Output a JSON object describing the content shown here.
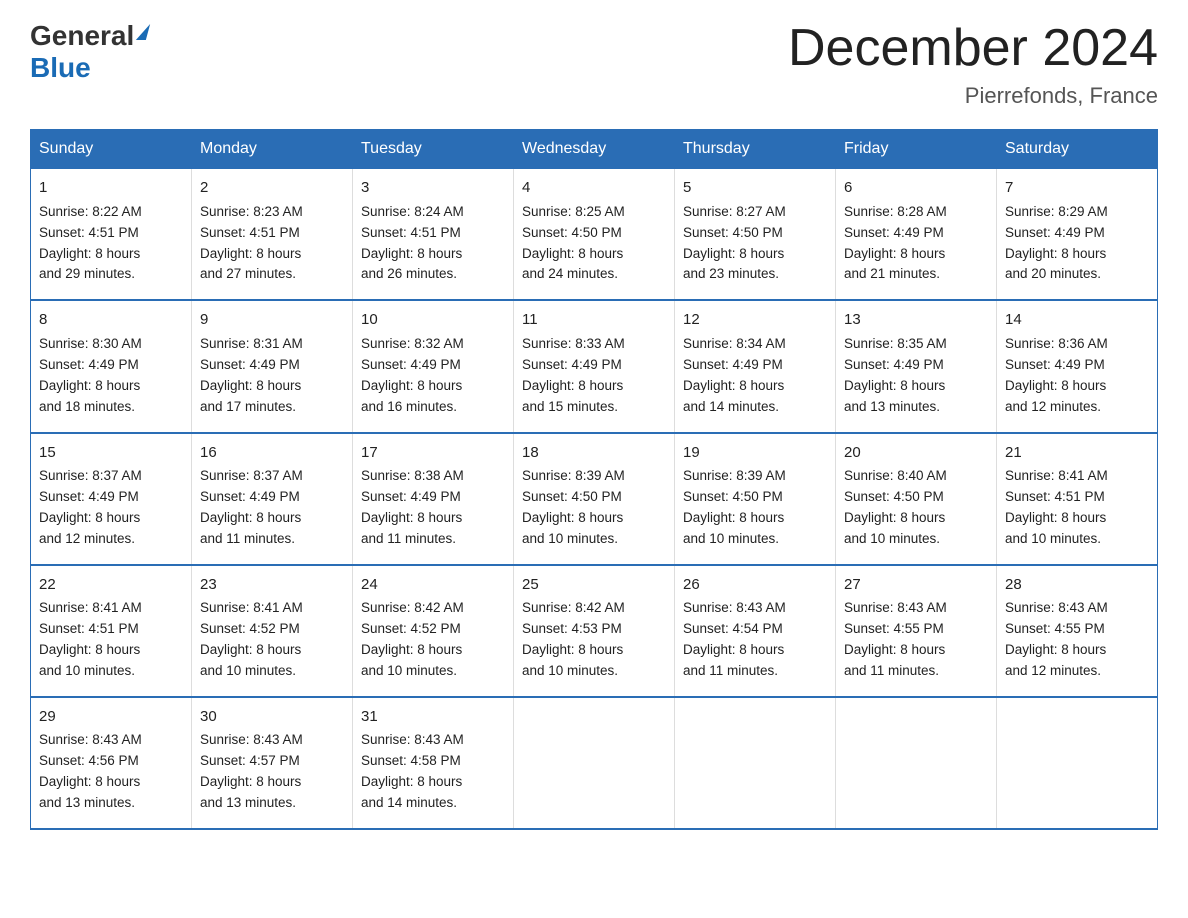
{
  "logo": {
    "general": "General",
    "blue": "Blue"
  },
  "header": {
    "title": "December 2024",
    "subtitle": "Pierrefonds, France"
  },
  "days_of_week": [
    "Sunday",
    "Monday",
    "Tuesday",
    "Wednesday",
    "Thursday",
    "Friday",
    "Saturday"
  ],
  "weeks": [
    [
      {
        "day": "1",
        "sunrise": "8:22 AM",
        "sunset": "4:51 PM",
        "daylight": "8 hours and 29 minutes."
      },
      {
        "day": "2",
        "sunrise": "8:23 AM",
        "sunset": "4:51 PM",
        "daylight": "8 hours and 27 minutes."
      },
      {
        "day": "3",
        "sunrise": "8:24 AM",
        "sunset": "4:51 PM",
        "daylight": "8 hours and 26 minutes."
      },
      {
        "day": "4",
        "sunrise": "8:25 AM",
        "sunset": "4:50 PM",
        "daylight": "8 hours and 24 minutes."
      },
      {
        "day": "5",
        "sunrise": "8:27 AM",
        "sunset": "4:50 PM",
        "daylight": "8 hours and 23 minutes."
      },
      {
        "day": "6",
        "sunrise": "8:28 AM",
        "sunset": "4:49 PM",
        "daylight": "8 hours and 21 minutes."
      },
      {
        "day": "7",
        "sunrise": "8:29 AM",
        "sunset": "4:49 PM",
        "daylight": "8 hours and 20 minutes."
      }
    ],
    [
      {
        "day": "8",
        "sunrise": "8:30 AM",
        "sunset": "4:49 PM",
        "daylight": "8 hours and 18 minutes."
      },
      {
        "day": "9",
        "sunrise": "8:31 AM",
        "sunset": "4:49 PM",
        "daylight": "8 hours and 17 minutes."
      },
      {
        "day": "10",
        "sunrise": "8:32 AM",
        "sunset": "4:49 PM",
        "daylight": "8 hours and 16 minutes."
      },
      {
        "day": "11",
        "sunrise": "8:33 AM",
        "sunset": "4:49 PM",
        "daylight": "8 hours and 15 minutes."
      },
      {
        "day": "12",
        "sunrise": "8:34 AM",
        "sunset": "4:49 PM",
        "daylight": "8 hours and 14 minutes."
      },
      {
        "day": "13",
        "sunrise": "8:35 AM",
        "sunset": "4:49 PM",
        "daylight": "8 hours and 13 minutes."
      },
      {
        "day": "14",
        "sunrise": "8:36 AM",
        "sunset": "4:49 PM",
        "daylight": "8 hours and 12 minutes."
      }
    ],
    [
      {
        "day": "15",
        "sunrise": "8:37 AM",
        "sunset": "4:49 PM",
        "daylight": "8 hours and 12 minutes."
      },
      {
        "day": "16",
        "sunrise": "8:37 AM",
        "sunset": "4:49 PM",
        "daylight": "8 hours and 11 minutes."
      },
      {
        "day": "17",
        "sunrise": "8:38 AM",
        "sunset": "4:49 PM",
        "daylight": "8 hours and 11 minutes."
      },
      {
        "day": "18",
        "sunrise": "8:39 AM",
        "sunset": "4:50 PM",
        "daylight": "8 hours and 10 minutes."
      },
      {
        "day": "19",
        "sunrise": "8:39 AM",
        "sunset": "4:50 PM",
        "daylight": "8 hours and 10 minutes."
      },
      {
        "day": "20",
        "sunrise": "8:40 AM",
        "sunset": "4:50 PM",
        "daylight": "8 hours and 10 minutes."
      },
      {
        "day": "21",
        "sunrise": "8:41 AM",
        "sunset": "4:51 PM",
        "daylight": "8 hours and 10 minutes."
      }
    ],
    [
      {
        "day": "22",
        "sunrise": "8:41 AM",
        "sunset": "4:51 PM",
        "daylight": "8 hours and 10 minutes."
      },
      {
        "day": "23",
        "sunrise": "8:41 AM",
        "sunset": "4:52 PM",
        "daylight": "8 hours and 10 minutes."
      },
      {
        "day": "24",
        "sunrise": "8:42 AM",
        "sunset": "4:52 PM",
        "daylight": "8 hours and 10 minutes."
      },
      {
        "day": "25",
        "sunrise": "8:42 AM",
        "sunset": "4:53 PM",
        "daylight": "8 hours and 10 minutes."
      },
      {
        "day": "26",
        "sunrise": "8:43 AM",
        "sunset": "4:54 PM",
        "daylight": "8 hours and 11 minutes."
      },
      {
        "day": "27",
        "sunrise": "8:43 AM",
        "sunset": "4:55 PM",
        "daylight": "8 hours and 11 minutes."
      },
      {
        "day": "28",
        "sunrise": "8:43 AM",
        "sunset": "4:55 PM",
        "daylight": "8 hours and 12 minutes."
      }
    ],
    [
      {
        "day": "29",
        "sunrise": "8:43 AM",
        "sunset": "4:56 PM",
        "daylight": "8 hours and 13 minutes."
      },
      {
        "day": "30",
        "sunrise": "8:43 AM",
        "sunset": "4:57 PM",
        "daylight": "8 hours and 13 minutes."
      },
      {
        "day": "31",
        "sunrise": "8:43 AM",
        "sunset": "4:58 PM",
        "daylight": "8 hours and 14 minutes."
      },
      null,
      null,
      null,
      null
    ]
  ],
  "labels": {
    "sunrise": "Sunrise:",
    "sunset": "Sunset:",
    "daylight": "Daylight:"
  }
}
